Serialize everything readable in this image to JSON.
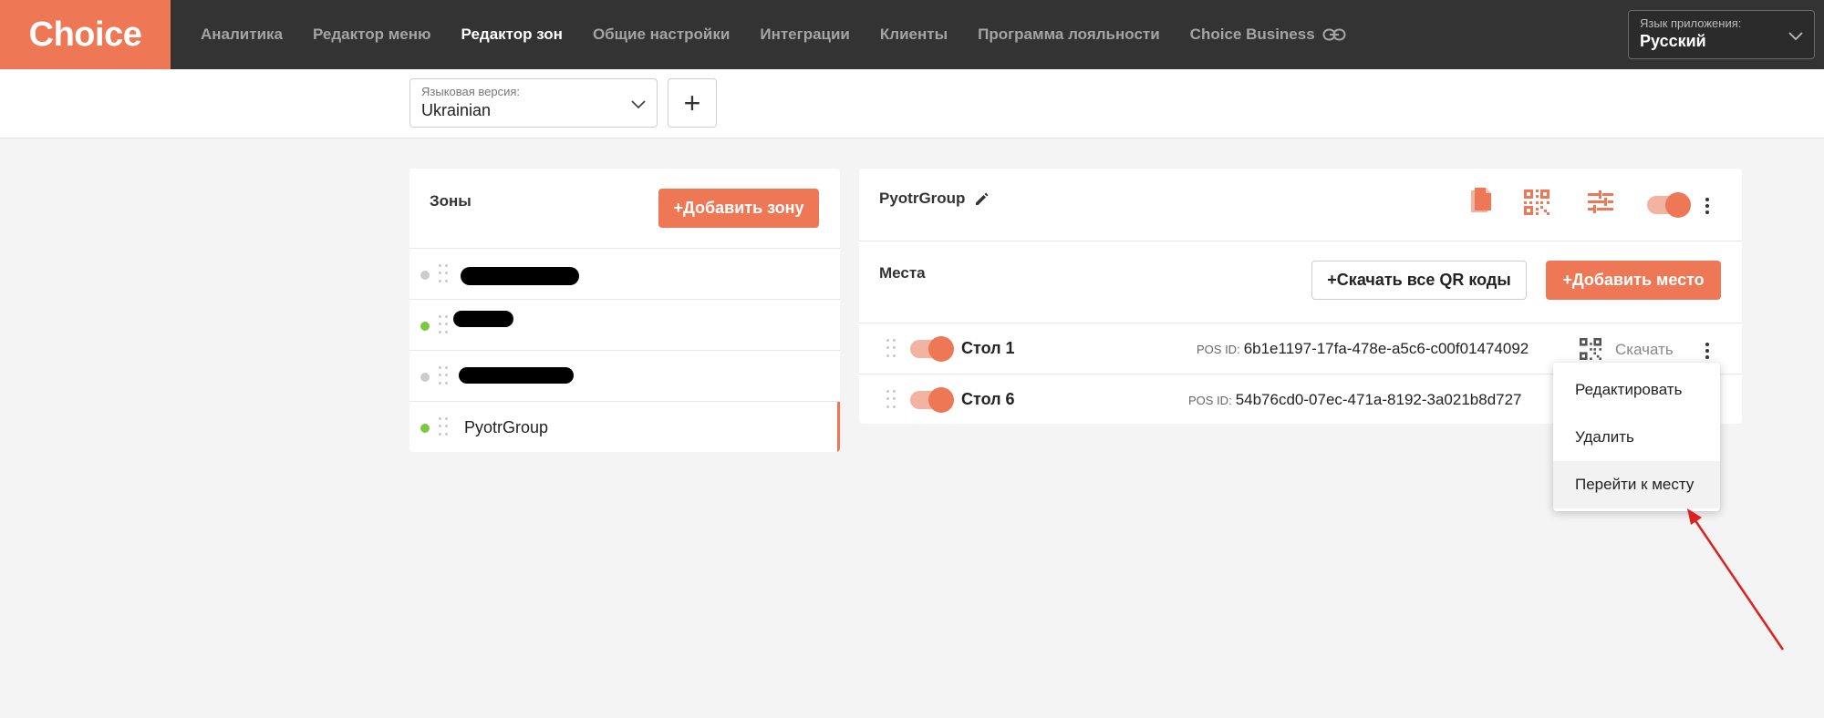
{
  "app": {
    "logo_text": "Choice",
    "accent_color": "#ee7755",
    "nav": [
      {
        "label": "Аналитика",
        "active": false
      },
      {
        "label": "Редактор меню",
        "active": false
      },
      {
        "label": "Редактор зон",
        "active": true
      },
      {
        "label": "Общие настройки",
        "active": false
      },
      {
        "label": "Интеграции",
        "active": false
      },
      {
        "label": "Клиенты",
        "active": false
      },
      {
        "label": "Программа лояльности",
        "active": false
      },
      {
        "label": "Choice Business",
        "active": false,
        "icon": "link-icon"
      }
    ],
    "app_language": {
      "label": "Язык приложения:",
      "value": "Русский"
    }
  },
  "subbar": {
    "version": {
      "label": "Языковая версия:",
      "value": "Ukrainian"
    },
    "add_symbol": "+"
  },
  "zones": {
    "title": "Зоны",
    "add_button": "+Добавить зону",
    "items": [
      {
        "name": "",
        "status": "gray",
        "redacted": true
      },
      {
        "name": "",
        "status": "green",
        "redacted": true
      },
      {
        "name": "",
        "status": "gray",
        "redacted": true
      },
      {
        "name": "PyotrGroup",
        "status": "green",
        "redacted": false,
        "selected": true
      }
    ]
  },
  "group": {
    "title": "PyotrGroup",
    "icons": [
      "copy-icon",
      "qr-code-icon",
      "settings-sliders-icon"
    ],
    "enabled": true
  },
  "places": {
    "title": "Места",
    "download_all": "+Скачать все QR коды",
    "add_button": "+Добавить место",
    "items": [
      {
        "name": "Стол 1",
        "pos_label": "POS ID:",
        "pos_id": "6b1e1197-17fa-478e-a5c6-c00f01474092",
        "download": "Скачать",
        "enabled": true
      },
      {
        "name": "Стол 6",
        "pos_label": "POS ID:",
        "pos_id": "54b76cd0-07ec-471a-8192-3a021b8d727",
        "enabled": true
      }
    ]
  },
  "context_menu": {
    "items": [
      "Редактировать",
      "Удалить",
      "Перейти к месту"
    ]
  }
}
